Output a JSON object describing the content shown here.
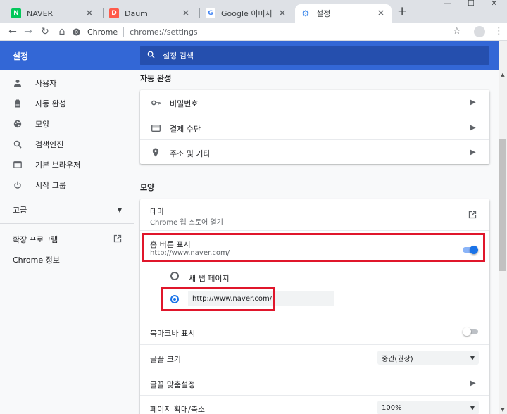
{
  "browser": {
    "tabs": [
      {
        "title": "NAVER",
        "favicon_text": "N",
        "favicon_color": "#03c75a"
      },
      {
        "title": "Daum",
        "favicon_text": "D",
        "favicon_color": "#ff5a4a"
      },
      {
        "title": "Google 이미지",
        "favicon_text": "G",
        "favicon_color": "#4285f4"
      },
      {
        "title": "설정",
        "favicon_text": "⚙",
        "favicon_color": "#1a73e8"
      }
    ],
    "new_tab_label": "+",
    "window_controls": {
      "minimize": "—",
      "maximize": "☐",
      "close": "✕"
    },
    "toolbar": {
      "back": "←",
      "forward": "→",
      "reload": "↻",
      "home": "⌂",
      "site_chip": "Chrome",
      "url": "chrome://settings",
      "star": "☆",
      "menu": "⋮"
    }
  },
  "settings": {
    "title": "설정",
    "search_placeholder": "설정 검색"
  },
  "sidebar": {
    "items": [
      {
        "label": "사용자",
        "icon": "person-icon"
      },
      {
        "label": "자동 완성",
        "icon": "clipboard-icon"
      },
      {
        "label": "모양",
        "icon": "palette-icon"
      },
      {
        "label": "검색엔진",
        "icon": "search-icon"
      },
      {
        "label": "기본 브라우저",
        "icon": "browser-icon"
      },
      {
        "label": "시작 그룹",
        "icon": "power-icon"
      }
    ],
    "advanced": "고급",
    "extensions": "확장 프로그램",
    "about": "Chrome 정보"
  },
  "autofill": {
    "title": "자동 완성",
    "rows": [
      {
        "label": "비밀번호",
        "icon": "key-icon"
      },
      {
        "label": "결제 수단",
        "icon": "credit-card-icon"
      },
      {
        "label": "주소 및 기타",
        "icon": "location-pin-icon"
      }
    ]
  },
  "appearance": {
    "title": "모양",
    "theme_label": "테마",
    "theme_sub": "Chrome 웹 스토어 열기",
    "home_label": "홈 버튼 표시",
    "home_sub": "http://www.naver.com/",
    "home_enabled": true,
    "radio_newtab": "새 탭 페이지",
    "radio_custom_value": "http://www.naver.com/",
    "bookmarks_label": "북마크바 표시",
    "bookmarks_enabled": false,
    "font_size_label": "글꼴 크기",
    "font_size_value": "중간(권장)",
    "customize_fonts_label": "글꼴 맞춤설정",
    "zoom_label": "페이지 확대/축소",
    "zoom_value": "100%"
  },
  "colors": {
    "accent": "#1a73e8",
    "header": "#3367d6",
    "annotation": "#e0162b"
  }
}
